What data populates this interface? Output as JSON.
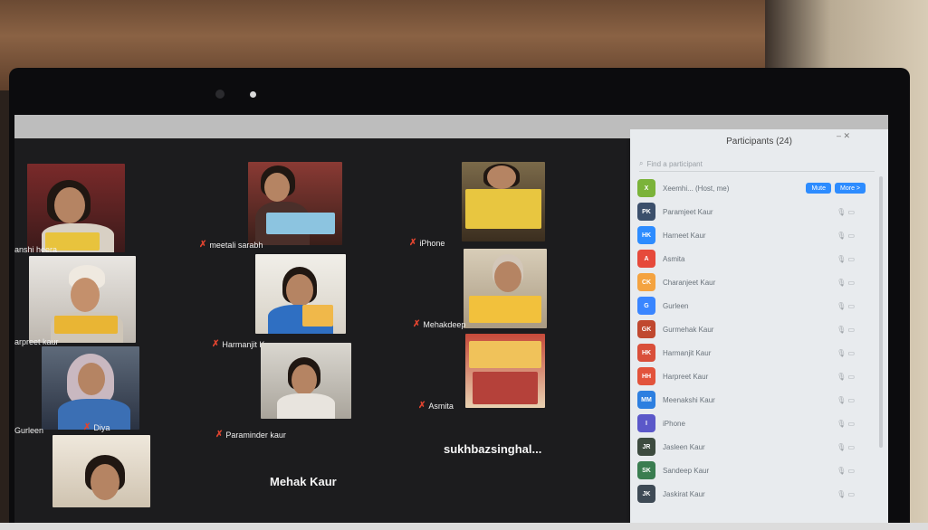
{
  "meeting": {
    "gallery_tiles": [
      {
        "name": "anshi heera"
      },
      {
        "name": "meetali sarabh"
      },
      {
        "name": "iPhone"
      },
      {
        "name": "arpreet kaur"
      },
      {
        "name": "Harmanjit Kaur"
      },
      {
        "name": "Mehakdeep"
      },
      {
        "name": "Diya"
      },
      {
        "name": "Paraminder kaur"
      },
      {
        "name": "Asmita"
      },
      {
        "name": "Gurleen"
      }
    ],
    "name_only_tiles": [
      "Mehak Kaur",
      "sukhbazsinghal..."
    ]
  },
  "participants_panel": {
    "title": "Participants (24)",
    "search_placeholder": "Find a participant",
    "mute_label": "Mute",
    "more_label": "More >",
    "items": [
      {
        "initials": "X",
        "name": "Xeemhi... (Host, me)",
        "color": "#7bb33a"
      },
      {
        "initials": "PK",
        "name": "Paramjeet Kaur",
        "color": "#3b4f6b"
      },
      {
        "initials": "HK",
        "name": "Harneet Kaur",
        "color": "#2d8cff"
      },
      {
        "initials": "A",
        "name": "Asmita",
        "color": "#e64a3b"
      },
      {
        "initials": "CK",
        "name": "Charanjeet Kaur",
        "color": "#f4a340"
      },
      {
        "initials": "G",
        "name": "Gurleen",
        "color": "#3a86ff"
      },
      {
        "initials": "GK",
        "name": "Gurmehak Kaur",
        "color": "#c0482f"
      },
      {
        "initials": "HK",
        "name": "Harmanjit Kaur",
        "color": "#d94f3a"
      },
      {
        "initials": "HH",
        "name": "Harpreet Kaur",
        "color": "#e2533b"
      },
      {
        "initials": "MM",
        "name": "Meenakshi Kaur",
        "color": "#2d7fe0"
      },
      {
        "initials": "I",
        "name": "iPhone",
        "color": "#5b58c9"
      },
      {
        "initials": "JR",
        "name": "Jasleen Kaur",
        "color": "#3d4b3f"
      },
      {
        "initials": "SK",
        "name": "Sandeep Kaur",
        "color": "#3a7d50"
      },
      {
        "initials": "JK",
        "name": "Jaskirat Kaur",
        "color": "#3e4a55"
      }
    ]
  }
}
